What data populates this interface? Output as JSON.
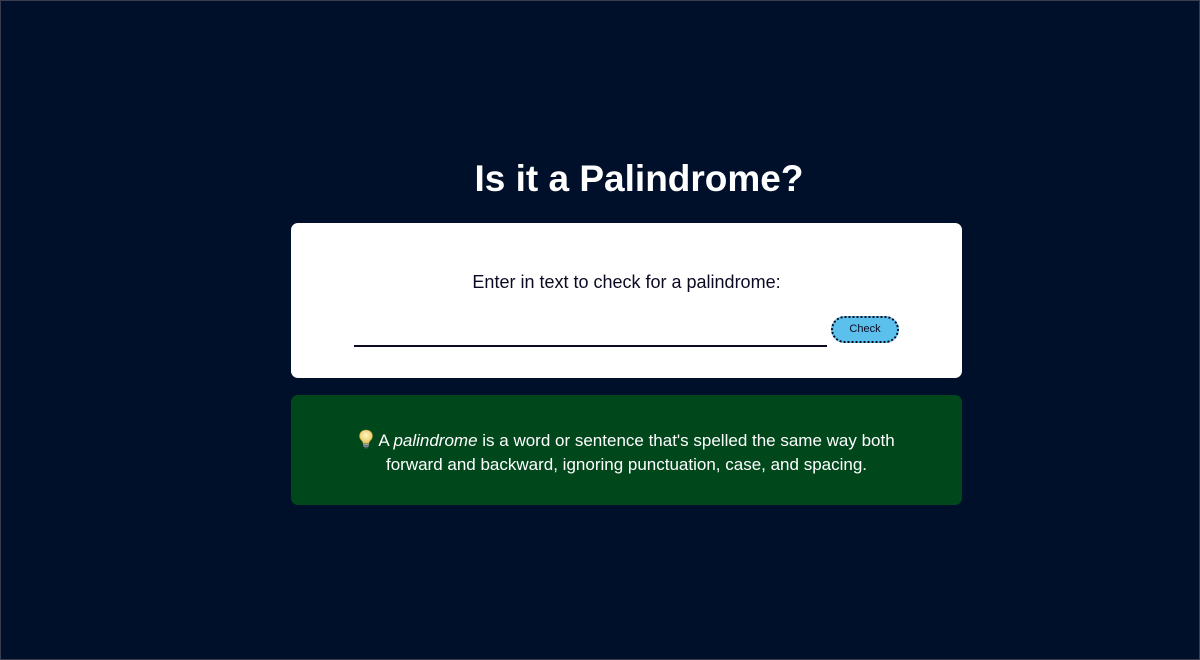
{
  "page": {
    "title": "Is it a Palindrome?"
  },
  "input_card": {
    "label": "Enter in text to check for a palindrome:",
    "input_value": "",
    "input_placeholder": "",
    "button_label": "Check"
  },
  "info_card": {
    "icon": "lightbulb-icon",
    "text_before": "A ",
    "text_emphasis": "palindrome",
    "text_after": " is a word or sentence that's spelled the same way both forward and backward, ignoring punctuation, case, and spacing."
  },
  "colors": {
    "background": "#00102b",
    "card": "#ffffff",
    "button": "#5bc0eb",
    "info_card": "#00471b",
    "text_dark": "#0a0a23",
    "text_light": "#ffffff"
  }
}
